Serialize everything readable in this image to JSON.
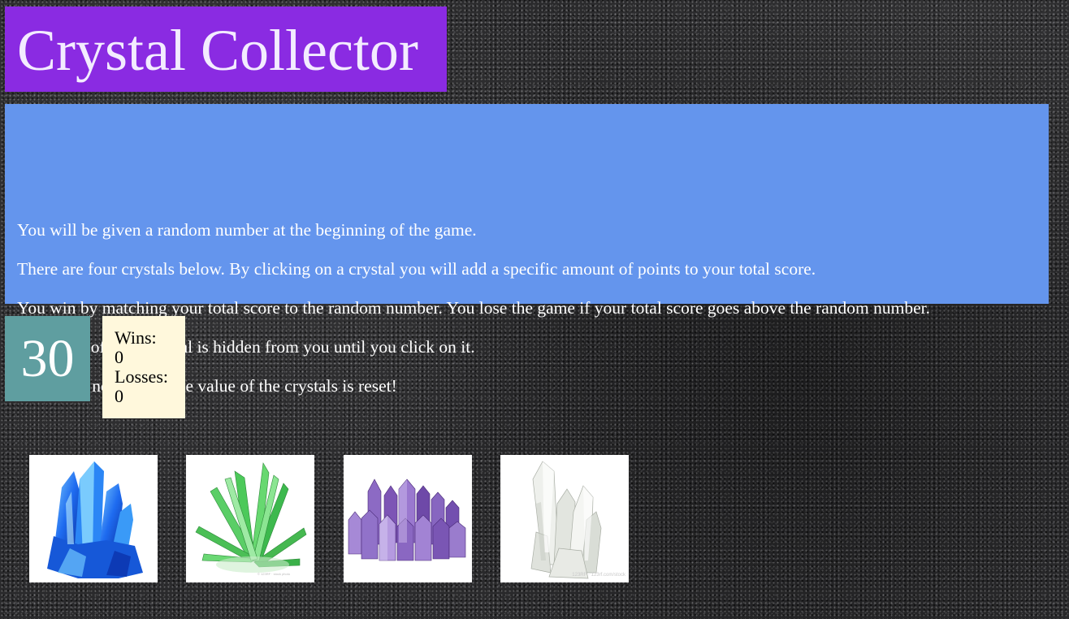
{
  "header": {
    "title": "Crystal Collector"
  },
  "instructions": [
    "You will be given a random number at the beginning of the game.",
    "There are four crystals below. By clicking on a crystal you will add a specific amount of points to your total score.",
    "You win by matching your total score to the random number. You lose the game if your total score goes above the random number.",
    "The value of each crystal is hidden from you until you click on it.",
    "With each new game, the value of the crystals is reset!"
  ],
  "target_number": "30",
  "scoreboard": {
    "wins_label": "Wins:",
    "wins_value": "0",
    "losses_label": "Losses:",
    "losses_value": "0"
  },
  "crystals": [
    {
      "name": "blue-crystal",
      "color": "#1e6bf0"
    },
    {
      "name": "green-crystal",
      "color": "#3db94e"
    },
    {
      "name": "purple-crystal",
      "color": "#7d55b5"
    },
    {
      "name": "clear-crystal",
      "color": "#d9ddd6",
      "watermark": "123RF · 123rf.com/stock"
    }
  ],
  "colors": {
    "title_bg": "#8a2be2",
    "instructions_bg": "#6495ed",
    "target_bg": "#5f9ea0",
    "score_bg": "#fff8dc"
  }
}
